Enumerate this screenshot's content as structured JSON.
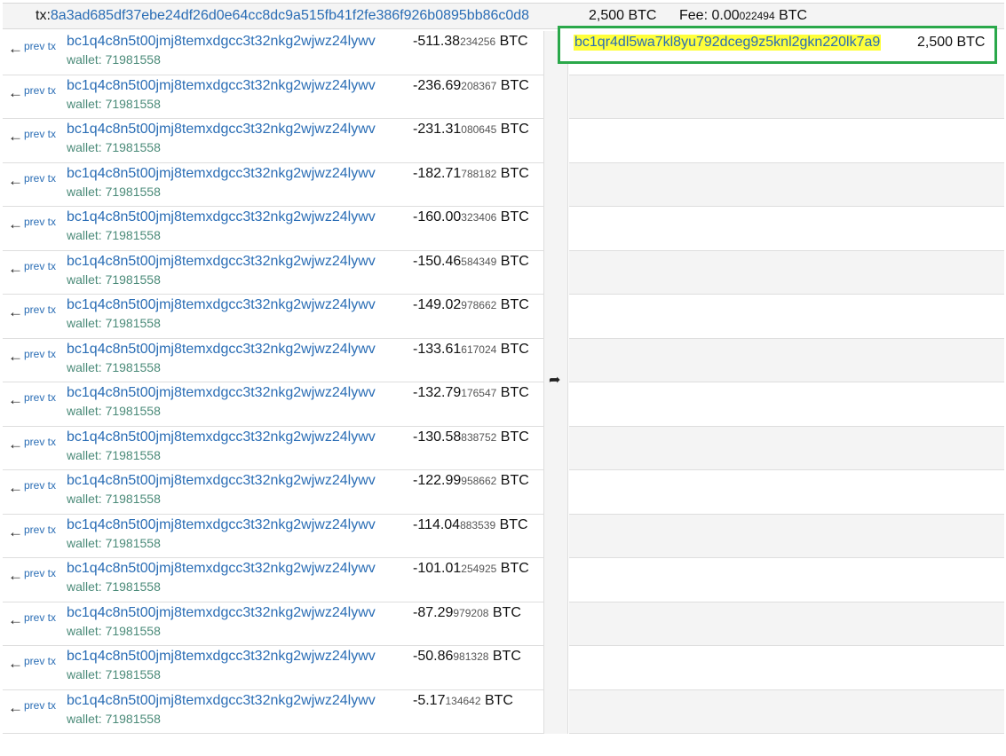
{
  "header": {
    "tx_label": "tx:",
    "tx_hash": "8a3ad685df37ebe24df26d0e64cc8dc9a515fb41f2fe386f926b0895bb86c0d8",
    "total_amount": "2,500 BTC",
    "fee_label": "Fee:",
    "fee_main": "0.00",
    "fee_small": "022494",
    "fee_unit": "BTC"
  },
  "inputs": [
    {
      "prev": "prev tx",
      "address": "bc1q4c8n5t00jmj8temxdgcc3t32nkg2wjwz24lywv",
      "wallet": "wallet: 71981558",
      "value_main": "-511.38",
      "value_small": "234256",
      "unit": "BTC"
    },
    {
      "prev": "prev tx",
      "address": "bc1q4c8n5t00jmj8temxdgcc3t32nkg2wjwz24lywv",
      "wallet": "wallet: 71981558",
      "value_main": "-236.69",
      "value_small": "208367",
      "unit": "BTC"
    },
    {
      "prev": "prev tx",
      "address": "bc1q4c8n5t00jmj8temxdgcc3t32nkg2wjwz24lywv",
      "wallet": "wallet: 71981558",
      "value_main": "-231.31",
      "value_small": "080645",
      "unit": "BTC"
    },
    {
      "prev": "prev tx",
      "address": "bc1q4c8n5t00jmj8temxdgcc3t32nkg2wjwz24lywv",
      "wallet": "wallet: 71981558",
      "value_main": "-182.71",
      "value_small": "788182",
      "unit": "BTC"
    },
    {
      "prev": "prev tx",
      "address": "bc1q4c8n5t00jmj8temxdgcc3t32nkg2wjwz24lywv",
      "wallet": "wallet: 71981558",
      "value_main": "-160.00",
      "value_small": "323406",
      "unit": "BTC"
    },
    {
      "prev": "prev tx",
      "address": "bc1q4c8n5t00jmj8temxdgcc3t32nkg2wjwz24lywv",
      "wallet": "wallet: 71981558",
      "value_main": "-150.46",
      "value_small": "584349",
      "unit": "BTC"
    },
    {
      "prev": "prev tx",
      "address": "bc1q4c8n5t00jmj8temxdgcc3t32nkg2wjwz24lywv",
      "wallet": "wallet: 71981558",
      "value_main": "-149.02",
      "value_small": "978662",
      "unit": "BTC"
    },
    {
      "prev": "prev tx",
      "address": "bc1q4c8n5t00jmj8temxdgcc3t32nkg2wjwz24lywv",
      "wallet": "wallet: 71981558",
      "value_main": "-133.61",
      "value_small": "617024",
      "unit": "BTC"
    },
    {
      "prev": "prev tx",
      "address": "bc1q4c8n5t00jmj8temxdgcc3t32nkg2wjwz24lywv",
      "wallet": "wallet: 71981558",
      "value_main": "-132.79",
      "value_small": "176547",
      "unit": "BTC"
    },
    {
      "prev": "prev tx",
      "address": "bc1q4c8n5t00jmj8temxdgcc3t32nkg2wjwz24lywv",
      "wallet": "wallet: 71981558",
      "value_main": "-130.58",
      "value_small": "838752",
      "unit": "BTC"
    },
    {
      "prev": "prev tx",
      "address": "bc1q4c8n5t00jmj8temxdgcc3t32nkg2wjwz24lywv",
      "wallet": "wallet: 71981558",
      "value_main": "-122.99",
      "value_small": "958662",
      "unit": "BTC"
    },
    {
      "prev": "prev tx",
      "address": "bc1q4c8n5t00jmj8temxdgcc3t32nkg2wjwz24lywv",
      "wallet": "wallet: 71981558",
      "value_main": "-114.04",
      "value_small": "883539",
      "unit": "BTC"
    },
    {
      "prev": "prev tx",
      "address": "bc1q4c8n5t00jmj8temxdgcc3t32nkg2wjwz24lywv",
      "wallet": "wallet: 71981558",
      "value_main": "-101.01",
      "value_small": "254925",
      "unit": "BTC"
    },
    {
      "prev": "prev tx",
      "address": "bc1q4c8n5t00jmj8temxdgcc3t32nkg2wjwz24lywv",
      "wallet": "wallet: 71981558",
      "value_main": "-87.29",
      "value_small": "979208",
      "unit": "BTC"
    },
    {
      "prev": "prev tx",
      "address": "bc1q4c8n5t00jmj8temxdgcc3t32nkg2wjwz24lywv",
      "wallet": "wallet: 71981558",
      "value_main": "-50.86",
      "value_small": "981328",
      "unit": "BTC"
    },
    {
      "prev": "prev tx",
      "address": "bc1q4c8n5t00jmj8temxdgcc3t32nkg2wjwz24lywv",
      "wallet": "wallet: 71981558",
      "value_main": "-5.17",
      "value_small": "134642",
      "unit": "BTC"
    }
  ],
  "output": {
    "address": "bc1qr4dl5wa7kl8yu792dceg9z5knl2gkn220lk7a9",
    "amount": "2,500 BTC"
  },
  "icons": {
    "prev_arrow": "arrow-left-icon",
    "direction": "share-forward-icon"
  },
  "colors": {
    "link": "#2a6db5",
    "wallet": "#4a8a78",
    "highlight": "#ffff3a",
    "box_border": "#2aa84a"
  }
}
